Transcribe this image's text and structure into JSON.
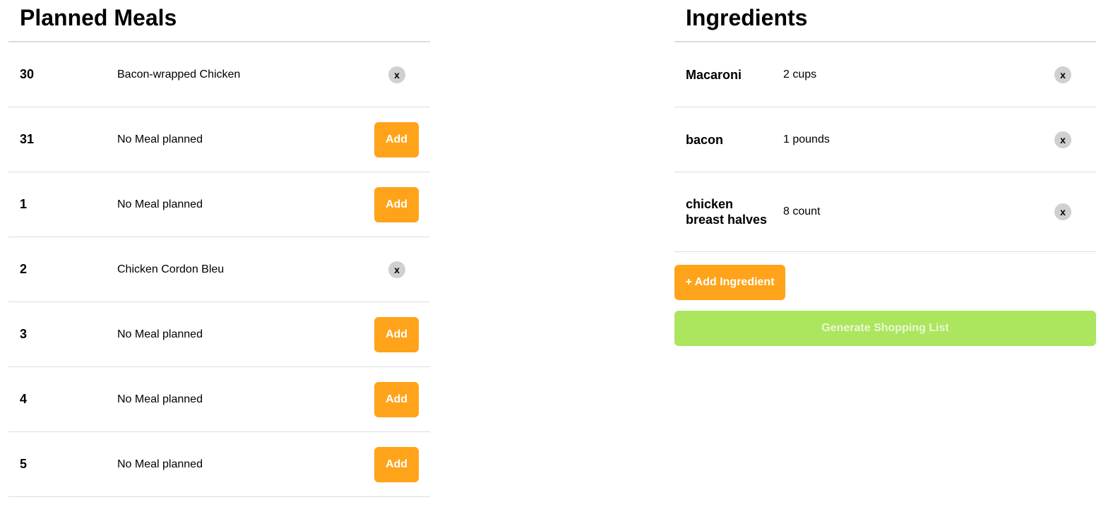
{
  "planned_meals": {
    "title": "Planned Meals",
    "rows": [
      {
        "day": "30",
        "meal": "Bacon-wrapped Chicken",
        "action": "x"
      },
      {
        "day": "31",
        "meal": "No Meal planned",
        "action": "Add"
      },
      {
        "day": "1",
        "meal": "No Meal planned",
        "action": "Add"
      },
      {
        "day": "2",
        "meal": "Chicken Cordon Bleu",
        "action": "x"
      },
      {
        "day": "3",
        "meal": "No Meal planned",
        "action": "Add"
      },
      {
        "day": "4",
        "meal": "No Meal planned",
        "action": "Add"
      },
      {
        "day": "5",
        "meal": "No Meal planned",
        "action": "Add"
      }
    ]
  },
  "ingredients": {
    "title": "Ingredients",
    "items": [
      {
        "name": "Macaroni",
        "quantity": "2 cups",
        "remove_label": "x"
      },
      {
        "name": "bacon",
        "quantity": "1 pounds",
        "remove_label": "x"
      },
      {
        "name": "chicken breast halves",
        "quantity": "8 count",
        "remove_label": "x"
      }
    ],
    "add_ingredient_label": "+ Add Ingredient",
    "generate_label": "Generate Shopping List"
  },
  "colors": {
    "accent_orange": "#ffa31a",
    "generate_green": "#ace55e",
    "remove_grey": "#d0d0d0",
    "divider": "#dcdcdc"
  }
}
